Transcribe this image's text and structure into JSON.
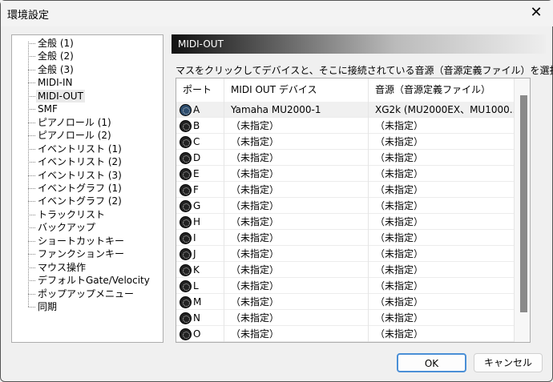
{
  "window": {
    "title": "環境設定",
    "close_icon": "close-icon"
  },
  "tree": {
    "items": [
      "全般 (1)",
      "全般 (2)",
      "全般 (3)",
      "MIDI-IN",
      "MIDI-OUT",
      "SMF",
      "ピアノロール (1)",
      "ピアノロール (2)",
      "イベントリスト (1)",
      "イベントリスト (2)",
      "イベントリスト (3)",
      "イベントグラフ (1)",
      "イベントグラフ (2)",
      "トラックリスト",
      "バックアップ",
      "ショートカットキー",
      "ファンクションキー",
      "マウス操作",
      "デフォルトGate/Velocity",
      "ポップアップメニュー",
      "同期"
    ],
    "selected": "MIDI-OUT"
  },
  "panel": {
    "header": "MIDI-OUT",
    "instruction": "マスをクリックしてデバイスと、そこに接続されている音源（音源定義ファイル）を選択し"
  },
  "table": {
    "columns": [
      "ポート",
      "MIDI OUT デバイス",
      "音源（音源定義ファイル）"
    ],
    "rows": [
      {
        "port": "A",
        "device": "Yamaha MU2000-1",
        "source": "XG2k (MU2000EX、MU1000...",
        "active": true
      },
      {
        "port": "B",
        "device": "（未指定）",
        "source": "（未指定）"
      },
      {
        "port": "C",
        "device": "（未指定）",
        "source": "（未指定）"
      },
      {
        "port": "D",
        "device": "（未指定）",
        "source": "（未指定）"
      },
      {
        "port": "E",
        "device": "（未指定）",
        "source": "（未指定）"
      },
      {
        "port": "F",
        "device": "（未指定）",
        "source": "（未指定）"
      },
      {
        "port": "G",
        "device": "（未指定）",
        "source": "（未指定）"
      },
      {
        "port": "H",
        "device": "（未指定）",
        "source": "（未指定）"
      },
      {
        "port": "I",
        "device": "（未指定）",
        "source": "（未指定）"
      },
      {
        "port": "J",
        "device": "（未指定）",
        "source": "（未指定）"
      },
      {
        "port": "K",
        "device": "（未指定）",
        "source": "（未指定）"
      },
      {
        "port": "L",
        "device": "（未指定）",
        "source": "（未指定）"
      },
      {
        "port": "M",
        "device": "（未指定）",
        "source": "（未指定）"
      },
      {
        "port": "N",
        "device": "（未指定）",
        "source": "（未指定）"
      },
      {
        "port": "O",
        "device": "（未指定）",
        "source": "（未指定）"
      },
      {
        "port": "",
        "device": "",
        "source": ""
      }
    ]
  },
  "buttons": {
    "ok": "OK",
    "cancel": "キャンセル"
  },
  "colors": {
    "ok_border": "#4a8fd6",
    "active_port": "#2d4d6e"
  }
}
